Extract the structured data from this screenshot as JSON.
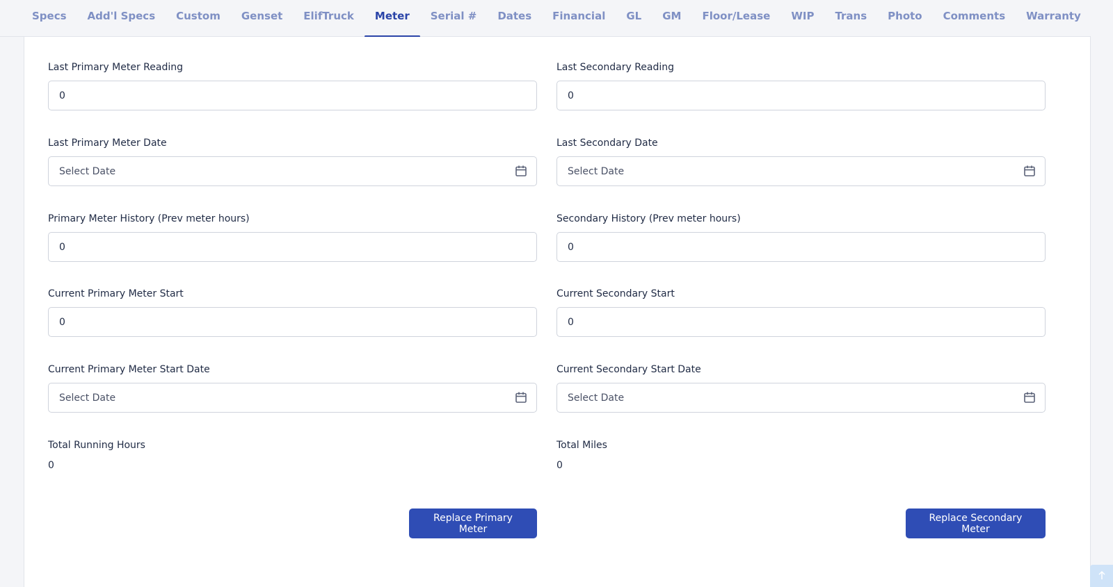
{
  "tabs": [
    {
      "label": "Specs"
    },
    {
      "label": "Add'l Specs"
    },
    {
      "label": "Custom"
    },
    {
      "label": "Genset"
    },
    {
      "label": "ElifTruck"
    },
    {
      "label": "Meter",
      "active": true
    },
    {
      "label": "Serial #"
    },
    {
      "label": "Dates"
    },
    {
      "label": "Financial"
    },
    {
      "label": "GL"
    },
    {
      "label": "GM"
    },
    {
      "label": "Floor/Lease"
    },
    {
      "label": "WIP"
    },
    {
      "label": "Trans"
    },
    {
      "label": "Photo"
    },
    {
      "label": "Comments"
    },
    {
      "label": "Warranty"
    }
  ],
  "primary": {
    "last_reading_label": "Last Primary Meter Reading",
    "last_reading_value": "0",
    "last_date_label": "Last Primary Meter Date",
    "last_date_placeholder": "Select Date",
    "history_label": "Primary Meter History (Prev meter hours)",
    "history_value": "0",
    "current_start_label": "Current Primary Meter Start",
    "current_start_value": "0",
    "current_start_date_label": "Current Primary Meter Start Date",
    "current_start_date_placeholder": "Select Date",
    "total_label": "Total Running Hours",
    "total_value": "0",
    "replace_button": "Replace Primary Meter"
  },
  "secondary": {
    "last_reading_label": "Last Secondary Reading",
    "last_reading_value": "0",
    "last_date_label": "Last Secondary Date",
    "last_date_placeholder": "Select Date",
    "history_label": "Secondary History (Prev meter hours)",
    "history_value": "0",
    "current_start_label": "Current Secondary Start",
    "current_start_value": "0",
    "current_start_date_label": "Current Secondary Start Date",
    "current_start_date_placeholder": "Select Date",
    "total_label": "Total Miles",
    "total_value": "0",
    "replace_button": "Replace Secondary Meter"
  },
  "icons": {
    "calendar": "calendar-icon",
    "scroll_top": "arrow-up-icon"
  },
  "colors": {
    "accent": "#2a44a8",
    "tab_inactive": "#7f90c4",
    "button": "#2f4db5"
  }
}
